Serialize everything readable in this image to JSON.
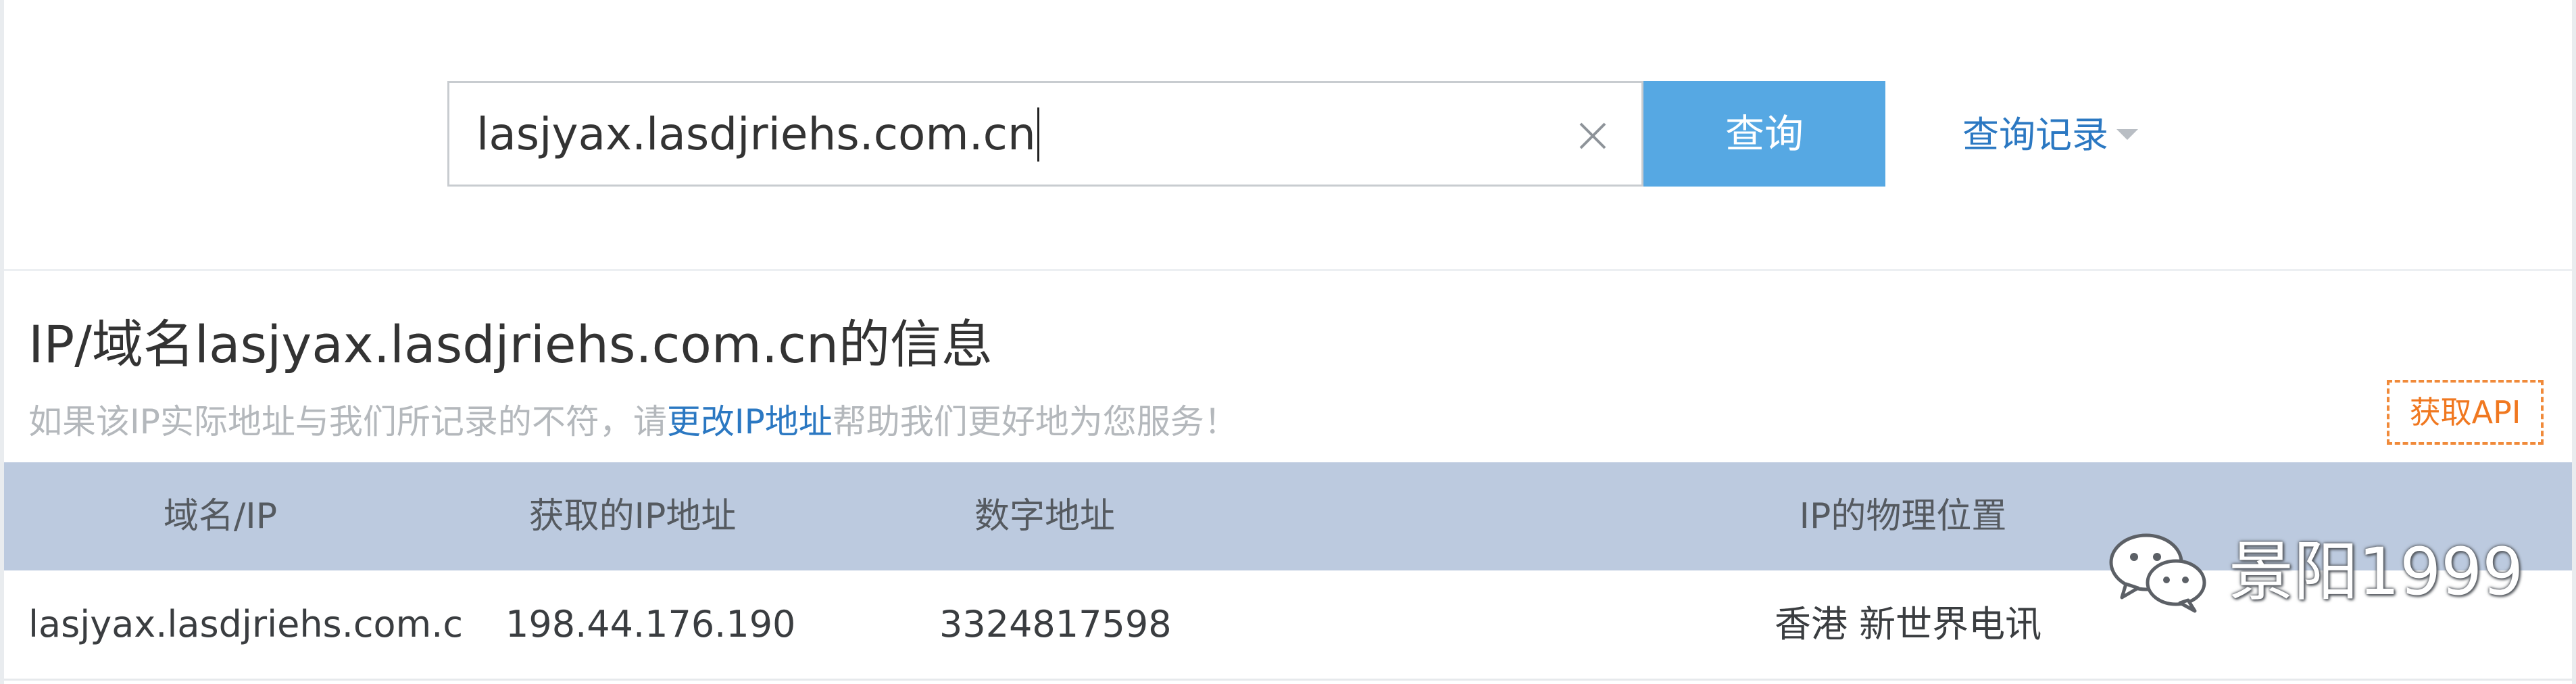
{
  "search": {
    "value": "lasjyax.lasdjriehs.com.cn",
    "button_label": "查询",
    "history_label": "查询记录"
  },
  "info": {
    "title": "IP/域名lasjyax.lasdjriehs.com.cn的信息",
    "notice_prefix": "如果该IP实际地址与我们所记录的不符，请",
    "notice_link": "更改IP地址",
    "notice_suffix": "帮助我们更好地为您服务！",
    "api_button_label": "获取API"
  },
  "table": {
    "headers": [
      "域名/IP",
      "获取的IP地址",
      "数字地址",
      "IP的物理位置"
    ],
    "rows": [
      [
        "lasjyax.lasdjriehs.com.c",
        "198.44.176.190",
        "3324817598",
        "香港 新世界电讯"
      ]
    ]
  },
  "watermark": {
    "text": "景阳1999"
  },
  "icons": {
    "clear": "close-icon",
    "history_dropdown": "caret-down-icon",
    "watermark_logo": "wechat-icon"
  },
  "colors": {
    "accent_button": "#56a8e3",
    "link": "#2b78c2",
    "api_orange": "#f07820",
    "table_header_bg": "#bccadf"
  }
}
